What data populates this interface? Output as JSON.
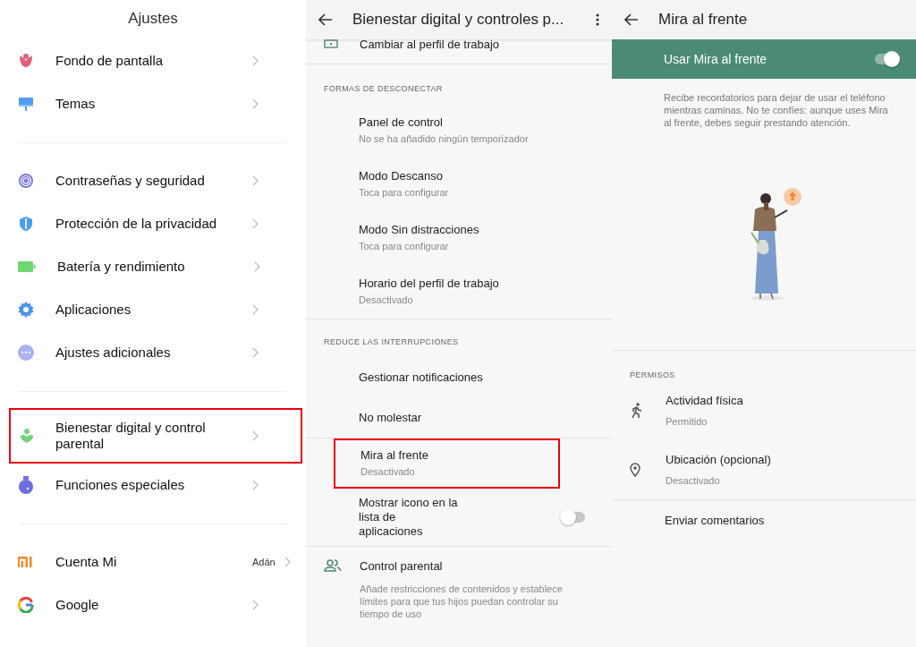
{
  "settings": {
    "title": "Ajustes",
    "groups": [
      [
        {
          "label": "Fondo de pantalla",
          "highlighted": false
        },
        {
          "label": "Temas",
          "highlighted": false
        }
      ],
      [
        {
          "label": "Contraseñas y seguridad",
          "highlighted": false
        },
        {
          "label": "Protección de la privacidad",
          "highlighted": false
        },
        {
          "label": "Batería y rendimiento",
          "highlighted": false
        },
        {
          "label": "Aplicaciones",
          "highlighted": false
        },
        {
          "label": "Ajustes adicionales",
          "highlighted": false
        }
      ],
      [
        {
          "label": "Bienestar digital y control parental",
          "highlighted": true
        },
        {
          "label": "Funciones especiales",
          "highlighted": false
        }
      ],
      [
        {
          "label": "Cuenta Mi",
          "value": "Adán",
          "highlighted": false
        },
        {
          "label": "Google",
          "highlighted": false
        }
      ]
    ]
  },
  "wellbeing": {
    "title": "Bienestar digital y controles p...",
    "top_item": {
      "label": "Cambiar al perfil de trabajo"
    },
    "sections": [
      {
        "header": "FORMAS DE DESCONECTAR",
        "items": [
          {
            "kind": "detail",
            "title": "Panel de control",
            "subtitle": "No se ha añadido ningún temporizador",
            "highlighted": false
          },
          {
            "kind": "detail",
            "title": "Modo Descanso",
            "subtitle": "Toca para configurar",
            "highlighted": false
          },
          {
            "kind": "detail",
            "title": "Modo Sin distracciones",
            "subtitle": "Toca para configurar",
            "highlighted": false
          },
          {
            "kind": "detail",
            "title": "Horario del perfil de trabajo",
            "subtitle": "Desactivado",
            "highlighted": false
          }
        ]
      },
      {
        "header": "REDUCE LAS INTERRUPCIONES",
        "items": [
          {
            "kind": "plain",
            "title": "Gestionar notificaciones",
            "highlighted": false
          },
          {
            "kind": "plain",
            "title": "No molestar",
            "highlighted": false
          },
          {
            "kind": "divider"
          },
          {
            "kind": "detail",
            "title": "Mira al frente",
            "subtitle": "Desactivado",
            "highlighted": true
          },
          {
            "kind": "toggle",
            "title": "Mostrar icono en la lista de aplicaciones",
            "on": false,
            "highlighted": false
          },
          {
            "kind": "divider"
          },
          {
            "kind": "parental",
            "title": "Control parental",
            "subtitle": "Añade restricciones de contenidos y establece límites para que tus hijos puedan controlar su tiempo de uso",
            "highlighted": false
          }
        ]
      }
    ]
  },
  "heads_up": {
    "title": "Mira al frente",
    "master": {
      "label": "Usar Mira al frente",
      "on": true
    },
    "description": "Recibe recordatorios para dejar de usar el teléfono mientras caminas. No te confíes: aunque uses Mira al frente, debes seguir prestando atención.",
    "permissions_header": "PERMISOS",
    "permissions": [
      {
        "title": "Actividad física",
        "status": "Permitido"
      },
      {
        "title": "Ubicación (opcional)",
        "status": "Desactivado"
      }
    ],
    "feedback": "Enviar comentarios"
  }
}
